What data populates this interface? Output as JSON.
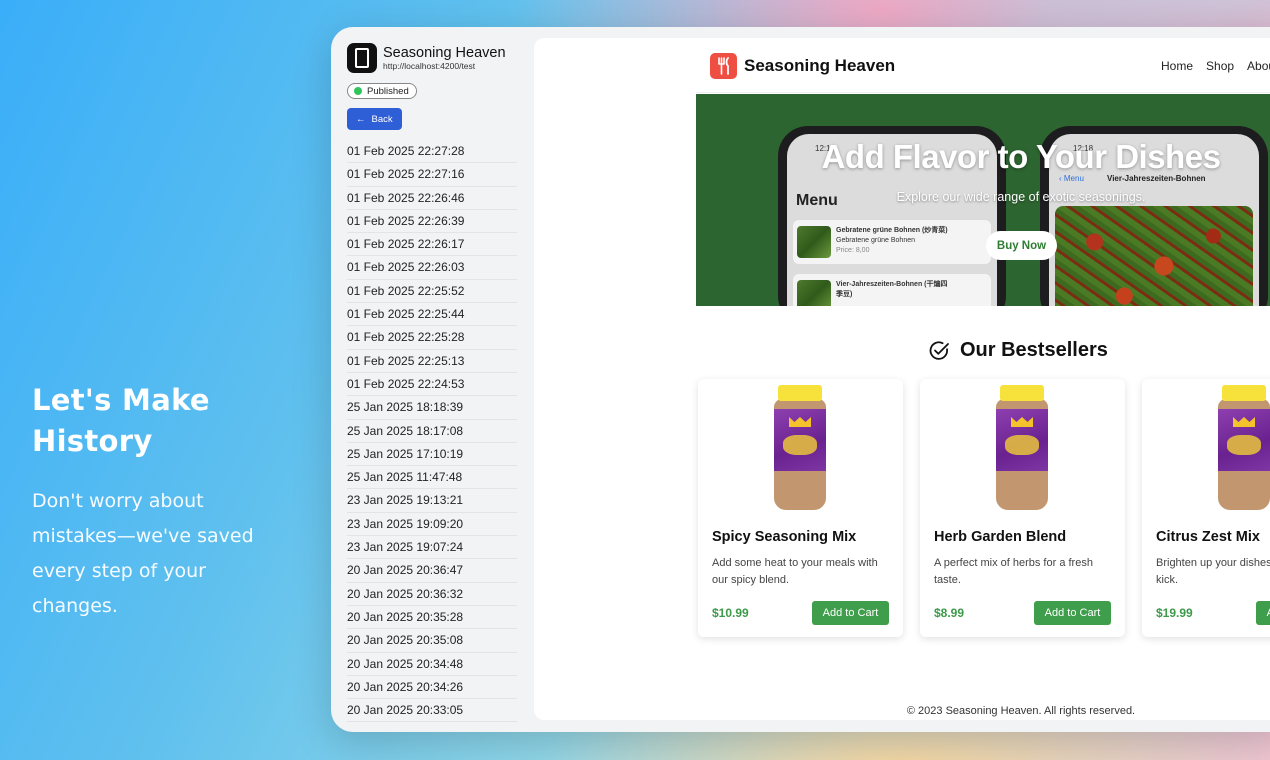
{
  "promo": {
    "heading": "Let's Make History",
    "body": "Don't worry about mistakes—we've saved every step of your changes."
  },
  "sidebar": {
    "site_name": "Seasoning Heaven",
    "site_url": "http://localhost:4200/test",
    "status": "Published",
    "back_label": "Back",
    "history": [
      "01 Feb 2025 22:27:28",
      "01 Feb 2025 22:27:16",
      "01 Feb 2025 22:26:46",
      "01 Feb 2025 22:26:39",
      "01 Feb 2025 22:26:17",
      "01 Feb 2025 22:26:03",
      "01 Feb 2025 22:25:52",
      "01 Feb 2025 22:25:44",
      "01 Feb 2025 22:25:28",
      "01 Feb 2025 22:25:13",
      "01 Feb 2025 22:24:53",
      "25 Jan 2025 18:18:39",
      "25 Jan 2025 18:17:08",
      "25 Jan 2025 17:10:19",
      "25 Jan 2025 11:47:48",
      "23 Jan 2025 19:13:21",
      "23 Jan 2025 19:09:20",
      "23 Jan 2025 19:07:24",
      "20 Jan 2025 20:36:47",
      "20 Jan 2025 20:36:32",
      "20 Jan 2025 20:35:28",
      "20 Jan 2025 20:35:08",
      "20 Jan 2025 20:34:48",
      "20 Jan 2025 20:34:26",
      "20 Jan 2025 20:33:05"
    ]
  },
  "site": {
    "brand": "Seasoning Heaven",
    "nav": [
      "Home",
      "Shop",
      "About"
    ],
    "hero": {
      "title": "Add Flavor to Your Dishes",
      "subtitle": "Explore our wide range of exotic seasonings.",
      "cta": "Buy Now",
      "phone_left": {
        "time": "12:17",
        "menu": "Menu",
        "item1_name": "Gebratene grüne Bohnen (炒青菜)",
        "item1_sub": "Gebratene grüne Bohnen",
        "item1_price": "Price: 8,00",
        "item2_name": "Vier-Jahreszeiten-Bohnen (干煸四",
        "item2_name2": "季豆)"
      },
      "phone_right": {
        "time": "12:18",
        "back": "Menu",
        "title": "Vier-Jahreszeiten-Bohnen"
      }
    },
    "bestsellers_title": "Our Bestsellers",
    "products": [
      {
        "name": "Spicy Seasoning Mix",
        "desc": "Add some heat to your meals with our spicy blend.",
        "price": "$10.99",
        "button": "Add to Cart"
      },
      {
        "name": "Herb Garden Blend",
        "desc": "A perfect mix of herbs for a fresh taste.",
        "price": "$8.99",
        "button": "Add to Cart"
      },
      {
        "name": "Citrus Zest Mix",
        "desc": "Brighten up your dishes with a citrus kick.",
        "price": "$19.99",
        "button": "Add to Cart"
      }
    ],
    "footer": "© 2023 Seasoning Heaven. All rights reserved."
  },
  "colors": {
    "accent_blue": "#2f5fd6",
    "hero_green": "#2d6530",
    "cart_green": "#3f9e4b",
    "logo_red": "#ef4e43",
    "published_green": "#2fc55b"
  }
}
